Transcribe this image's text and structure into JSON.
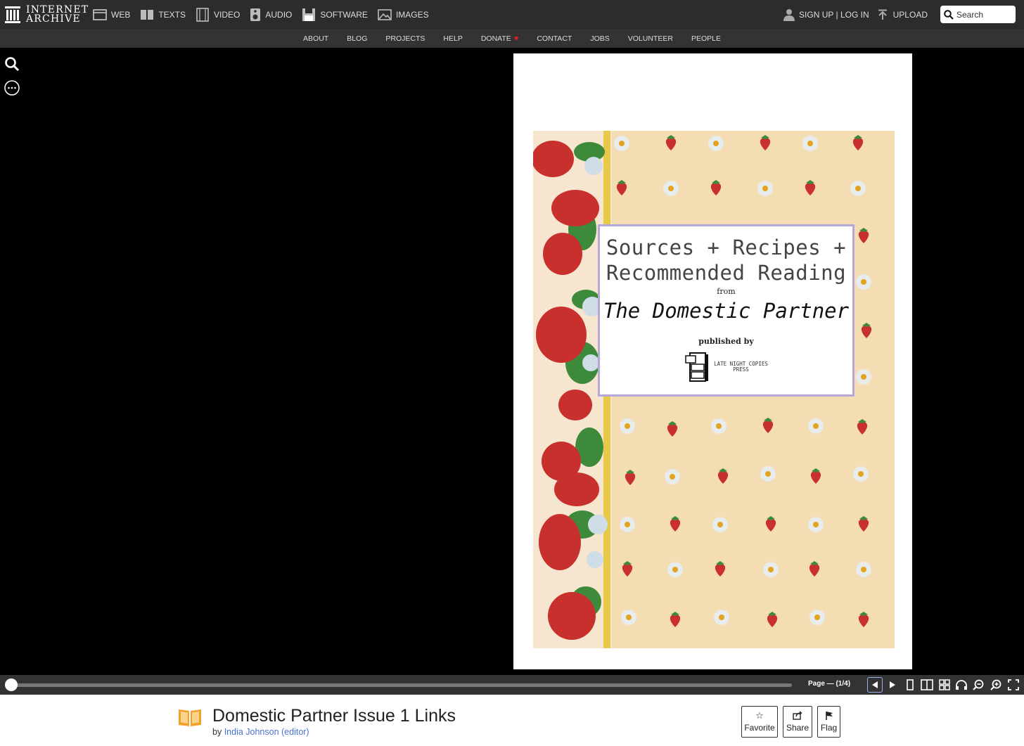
{
  "header": {
    "logo_line1": "INTERNET",
    "logo_line2": "ARCHIVE",
    "media": [
      {
        "label": "WEB",
        "icon": "web-icon"
      },
      {
        "label": "TEXTS",
        "icon": "texts-icon"
      },
      {
        "label": "VIDEO",
        "icon": "video-icon"
      },
      {
        "label": "AUDIO",
        "icon": "audio-icon"
      },
      {
        "label": "SOFTWARE",
        "icon": "software-icon"
      },
      {
        "label": "IMAGES",
        "icon": "images-icon"
      }
    ],
    "signup_label": "SIGN UP | LOG IN",
    "upload_label": "UPLOAD",
    "search_placeholder": "Search"
  },
  "subnav": [
    "ABOUT",
    "BLOG",
    "PROJECTS",
    "HELP",
    "DONATE",
    "CONTACT",
    "JOBS",
    "VOLUNTEER",
    "PEOPLE"
  ],
  "cover": {
    "line1": "Sources + Recipes +",
    "line2": "Recommended Reading",
    "from": "from",
    "publication": "The Domestic Partner",
    "published_by": "published by",
    "press_line1": "LATE NIGHT COPIES",
    "press_line2": "PRESS",
    "background_color": "#f4dcb3",
    "frame_color": "#b5a8d8"
  },
  "controls": {
    "page_label": "Page — (1/4)",
    "progress": 0.0
  },
  "details": {
    "title": "Domestic Partner Issue 1 Links",
    "by": "by",
    "author": "India Johnson (editor)",
    "actions": [
      {
        "label": "Favorite",
        "icon": "star-icon"
      },
      {
        "label": "Share",
        "icon": "share-icon"
      },
      {
        "label": "Flag",
        "icon": "flag-icon"
      }
    ]
  }
}
